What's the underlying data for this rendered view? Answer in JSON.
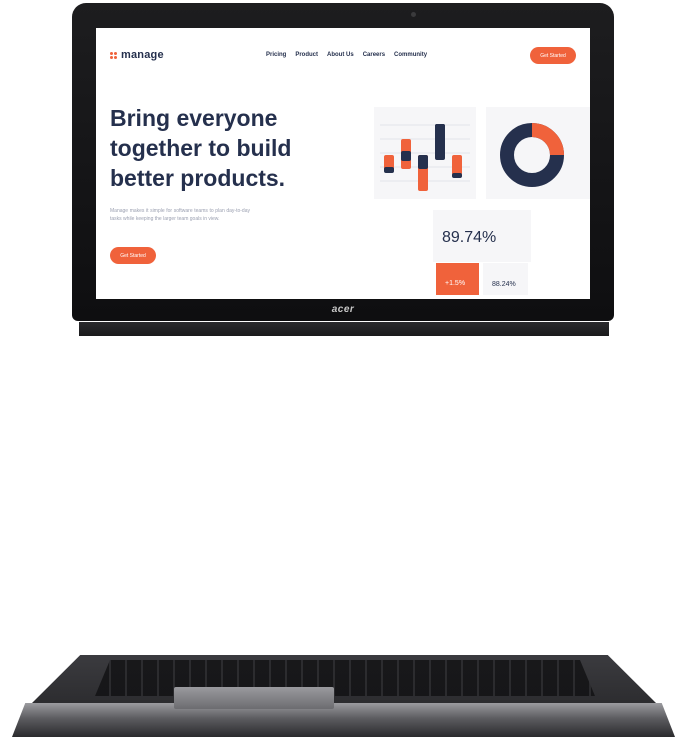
{
  "laptop": {
    "brand_label": "acer"
  },
  "site": {
    "logo_text": "manage",
    "nav": [
      "Pricing",
      "Product",
      "About Us",
      "Careers",
      "Community"
    ],
    "cta_top": "Get Started",
    "hero_title": "Bring everyone together to build better products.",
    "hero_text": "Manage makes it simple for software teams to plan day-to-day tasks while keeping the larger team goals in view.",
    "cta_main": "Get Started",
    "colors": {
      "accent": "#f0623b",
      "navy": "#25304d",
      "muted": "#9a9fb0",
      "card_bg": "#f6f6f8"
    }
  },
  "stats": {
    "big_value": "89.74%",
    "change_value": "+1.5%",
    "small_value": "88.24%"
  }
}
